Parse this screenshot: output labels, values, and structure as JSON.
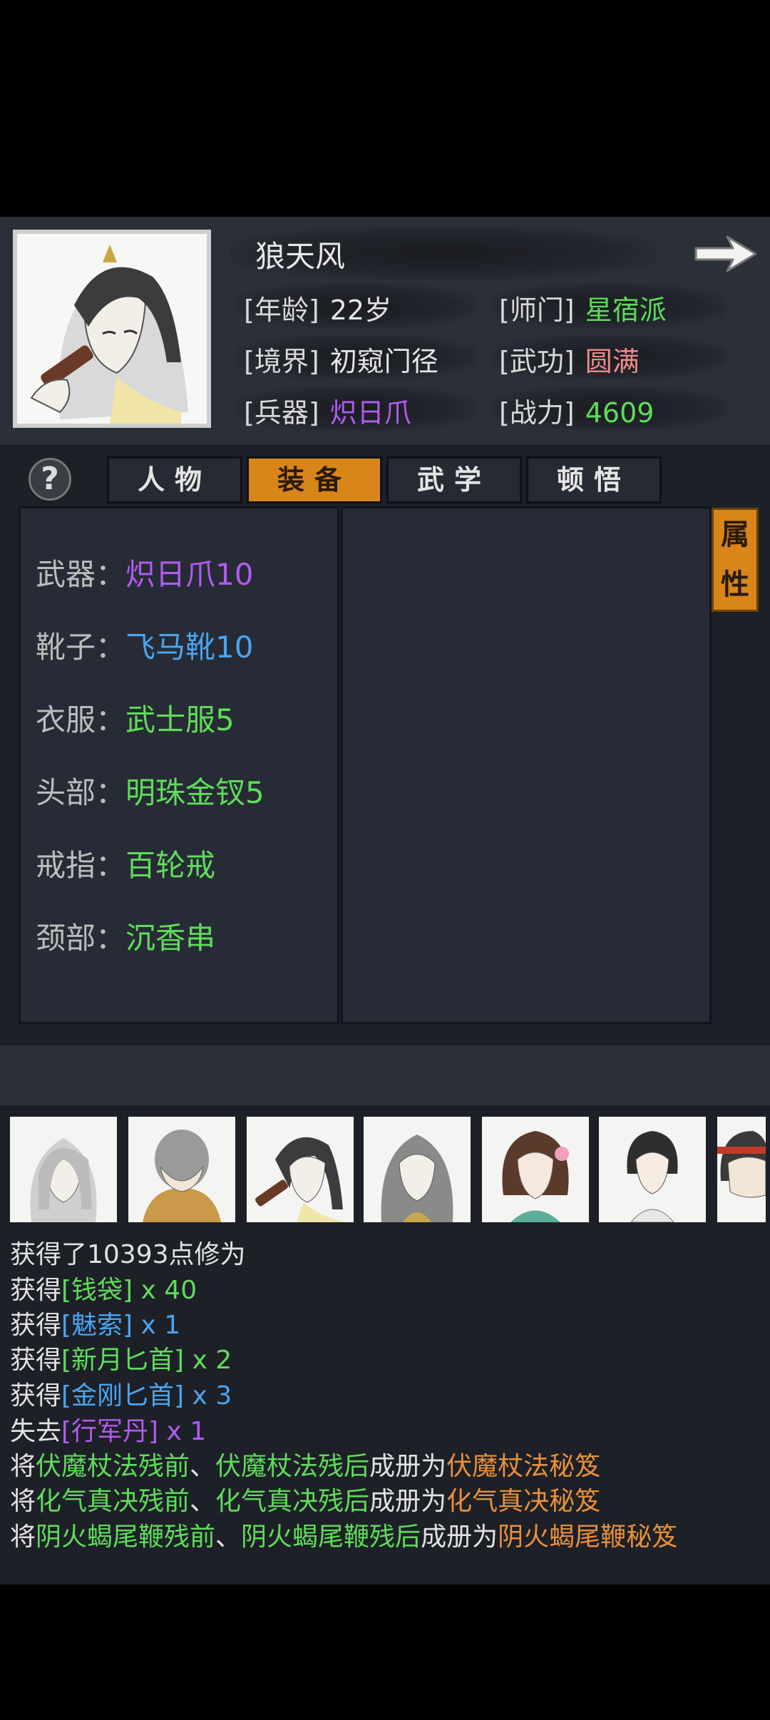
{
  "character": {
    "name": "狼天风",
    "stats": [
      {
        "label": "[年龄]",
        "value": "22岁",
        "color": "#e6e6e6"
      },
      {
        "label": "[师门]",
        "value": "星宿派",
        "color": "#5fdc5a"
      },
      {
        "label": "[境界]",
        "value": "初窥门径",
        "color": "#e6e6e6"
      },
      {
        "label": "[武功]",
        "value": "圆满",
        "color": "#f08a8a"
      },
      {
        "label": "[兵器]",
        "value": "炽日爪",
        "color": "#b05cf0"
      },
      {
        "label": "[战力]",
        "value": "4609",
        "color": "#5fdc5a"
      }
    ]
  },
  "help_label": "?",
  "tabs": [
    {
      "label": "人物",
      "active": false
    },
    {
      "label": "装备",
      "active": true
    },
    {
      "label": "武学",
      "active": false
    },
    {
      "label": "顿悟",
      "active": false
    }
  ],
  "side_tab": {
    "char1": "属",
    "char2": "性"
  },
  "equipment": [
    {
      "label": "武器：",
      "value": "炽日爪10",
      "color": "#b05cf0"
    },
    {
      "label": "靴子：",
      "value": "飞马靴10",
      "color": "#4aa4f0"
    },
    {
      "label": "衣服：",
      "value": "武士服5",
      "color": "#5fdc5a"
    },
    {
      "label": "头部：",
      "value": "明珠金钗5",
      "color": "#5fdc5a"
    },
    {
      "label": "戒指：",
      "value": "百轮戒",
      "color": "#5fdc5a"
    },
    {
      "label": "颈部：",
      "value": "沉香串",
      "color": "#5fdc5a"
    }
  ],
  "log": [
    [
      {
        "t": "获得了10393点修为",
        "c": "#e2e2e2"
      }
    ],
    [
      {
        "t": "获得",
        "c": "#e2e2e2"
      },
      {
        "t": "[钱袋]",
        "c": "#5fdc5a"
      },
      {
        "t": " x 40",
        "c": "#5fdc5a"
      }
    ],
    [
      {
        "t": "获得",
        "c": "#e2e2e2"
      },
      {
        "t": "[魅索]",
        "c": "#4aa4f0"
      },
      {
        "t": " x 1",
        "c": "#4aa4f0"
      }
    ],
    [
      {
        "t": "获得",
        "c": "#e2e2e2"
      },
      {
        "t": "[新月匕首]",
        "c": "#5fdc5a"
      },
      {
        "t": " x 2",
        "c": "#5fdc5a"
      }
    ],
    [
      {
        "t": "获得",
        "c": "#e2e2e2"
      },
      {
        "t": "[金刚匕首]",
        "c": "#4aa4f0"
      },
      {
        "t": " x 3",
        "c": "#4aa4f0"
      }
    ],
    [
      {
        "t": "失去",
        "c": "#e2e2e2"
      },
      {
        "t": "[行军丹]",
        "c": "#b05cf0"
      },
      {
        "t": " x 1",
        "c": "#b05cf0"
      }
    ],
    [
      {
        "t": "将",
        "c": "#e2e2e2"
      },
      {
        "t": "伏魔杖法残前",
        "c": "#5fdc5a"
      },
      {
        "t": "、",
        "c": "#e2e2e2"
      },
      {
        "t": "伏魔杖法残后",
        "c": "#5fdc5a"
      },
      {
        "t": "成册为",
        "c": "#e2e2e2"
      },
      {
        "t": "伏魔杖法秘笈",
        "c": "#e8903a"
      }
    ],
    [
      {
        "t": "将",
        "c": "#e2e2e2"
      },
      {
        "t": "化气真决残前",
        "c": "#5fdc5a"
      },
      {
        "t": "、",
        "c": "#e2e2e2"
      },
      {
        "t": "化气真决残后",
        "c": "#5fdc5a"
      },
      {
        "t": "成册为",
        "c": "#e2e2e2"
      },
      {
        "t": "化气真决秘笈",
        "c": "#e8903a"
      }
    ],
    [
      {
        "t": "将",
        "c": "#e2e2e2"
      },
      {
        "t": "阴火蝎尾鞭残前",
        "c": "#5fdc5a"
      },
      {
        "t": "、",
        "c": "#e2e2e2"
      },
      {
        "t": "阴火蝎尾鞭残后",
        "c": "#5fdc5a"
      },
      {
        "t": "成册为",
        "c": "#e2e2e2"
      },
      {
        "t": "阴火蝎尾鞭秘笈",
        "c": "#e8903a"
      }
    ]
  ],
  "party_thumbnails": [
    "long-hair-man",
    "bald-monk",
    "scholar-with-fan",
    "long-hair-woman",
    "flower-maiden",
    "young-girl",
    "headband-man"
  ]
}
